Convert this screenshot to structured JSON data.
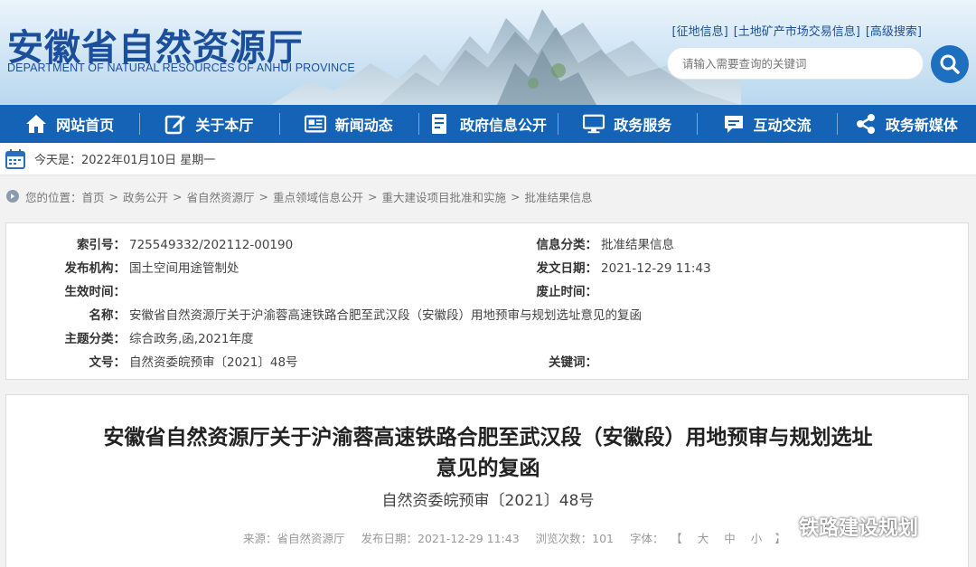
{
  "header": {
    "logo_cn": "安徽省自然资源厅",
    "logo_en": "DEPARTMENT OF NATURAL RESOURCES OF ANHUI PROVINCE",
    "top_links": [
      "[征地信息]",
      "[土地矿产市场交易信息]",
      "[高级搜索]"
    ],
    "search_placeholder": "请输入需要查询的关键词"
  },
  "nav": [
    {
      "label": "网站首页",
      "icon": "home-icon"
    },
    {
      "label": "关于本厅",
      "icon": "edit-icon"
    },
    {
      "label": "新闻动态",
      "icon": "news-icon"
    },
    {
      "label": "政府信息公开",
      "icon": "document-icon"
    },
    {
      "label": "政务服务",
      "icon": "monitor-icon"
    },
    {
      "label": "互动交流",
      "icon": "chat-icon"
    },
    {
      "label": "政务新媒体",
      "icon": "share-icon"
    }
  ],
  "datebar": {
    "text": "今天是：2022年01月10日 星期一"
  },
  "breadcrumb": {
    "prefix": "您的位置：",
    "items": [
      "首页",
      "政务公开",
      "省自然资源厅",
      "重点领域信息公开",
      "重大建设项目批准和实施",
      "批准结果信息"
    ],
    "separator": ">"
  },
  "info": {
    "index_label": "索引号：",
    "index_value": "725549332/202112-00190",
    "category_label": "信息分类：",
    "category_value": "批准结果信息",
    "publisher_label": "发布机构：",
    "publisher_value": "国土空间用途管制处",
    "date_label": "发文日期：",
    "date_value": "2021-12-29 11:43",
    "effective_label": "生效时间：",
    "effective_value": "",
    "expire_label": "废止时间：",
    "expire_value": "",
    "name_label": "名称：",
    "name_value": "安徽省自然资源厅关于沪渝蓉高速铁路合肥至武汉段（安徽段）用地预审与规划选址意见的复函",
    "topic_label": "主题分类：",
    "topic_value": "综合政务,函,2021年度",
    "docno_label": "文号：",
    "docno_value": "自然资委皖预审〔2021〕48号",
    "keywords_label": "关键词：",
    "keywords_value": ""
  },
  "article": {
    "title_line1": "安徽省自然资源厅关于沪渝蓉高速铁路合肥至武汉段（安徽段）用地预审与规划选址",
    "title_line2": "意见的复函",
    "subtitle": "自然资委皖预审〔2021〕48号",
    "source": "来源：省自然资源厅",
    "publish": "发布日期：2021-12-29 11:43",
    "views": "浏览次数：101",
    "font_label": "字体：",
    "font_open": "【",
    "font_large": "大",
    "font_medium": "中",
    "font_small": "小",
    "font_close": "】"
  },
  "watermark": {
    "text": "铁路建设规划"
  },
  "colors": {
    "nav_bg": "#1563b6",
    "brand": "#1b4f9c",
    "search_btn": "#1f6fc0"
  }
}
